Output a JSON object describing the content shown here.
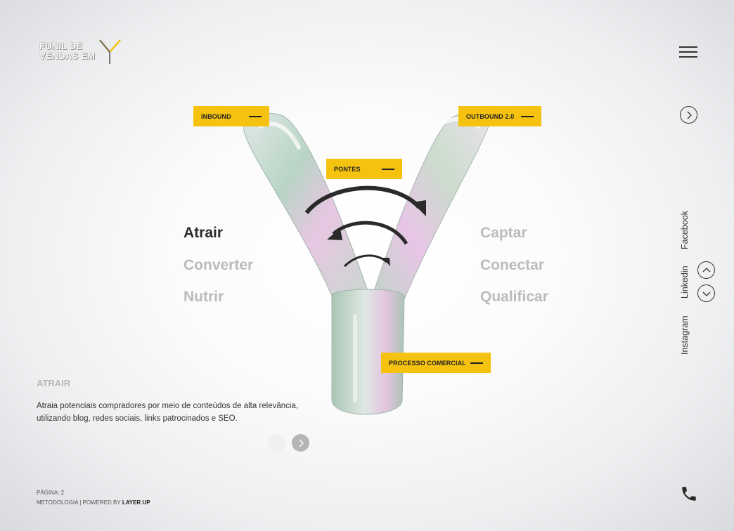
{
  "logo": {
    "line1": "FUNIL DE",
    "line2": "VENDAS EM"
  },
  "tags": {
    "inbound": "INBOUND",
    "outbound": "OUTBOUND 2.0",
    "pontes": "PONTES",
    "processo": "PROCESSO COMERCIAL"
  },
  "left_words": [
    "Atrair",
    "Converter",
    "Nutrir"
  ],
  "right_words": [
    "Captar",
    "Conectar",
    "Qualificar"
  ],
  "section": {
    "title": "ATRAIR",
    "description": "Atraia potenciais compradores por meio de conteúdos de alta relevância, utilizando blog, redes sociais, links patrocinados e SEO."
  },
  "social": [
    "Facebook",
    "Linkedin",
    "Instagram"
  ],
  "footer": {
    "page_label": "PÁGINA: 2",
    "credits_prefix": "METODOLOGIA | POWERED BY ",
    "credits_brand": "LAYER UP"
  },
  "colors": {
    "accent": "#f4c20f",
    "text": "#2b2b2b",
    "inactive": "#bbbbbb"
  },
  "icons": [
    "menu-icon",
    "chevron-right-icon",
    "chevron-up-icon",
    "chevron-down-icon",
    "phone-icon"
  ]
}
